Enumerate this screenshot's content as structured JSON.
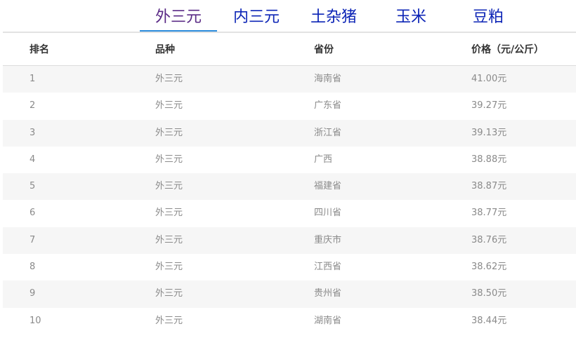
{
  "tabs": [
    {
      "label": "外三元",
      "active": true
    },
    {
      "label": "内三元",
      "active": false
    },
    {
      "label": "土杂猪",
      "active": false
    },
    {
      "label": "玉米",
      "active": false
    },
    {
      "label": "豆粕",
      "active": false
    }
  ],
  "table": {
    "headers": {
      "rank": "排名",
      "breed": "品种",
      "province": "省份",
      "price": "价格（元/公斤）"
    },
    "rows": [
      {
        "rank": "1",
        "breed": "外三元",
        "province": "海南省",
        "price": "41.00元"
      },
      {
        "rank": "2",
        "breed": "外三元",
        "province": "广东省",
        "price": "39.27元"
      },
      {
        "rank": "3",
        "breed": "外三元",
        "province": "浙江省",
        "price": "39.13元"
      },
      {
        "rank": "4",
        "breed": "外三元",
        "province": "广西",
        "price": "38.88元"
      },
      {
        "rank": "5",
        "breed": "外三元",
        "province": "福建省",
        "price": "38.87元"
      },
      {
        "rank": "6",
        "breed": "外三元",
        "province": "四川省",
        "price": "38.77元"
      },
      {
        "rank": "7",
        "breed": "外三元",
        "province": "重庆市",
        "price": "38.76元"
      },
      {
        "rank": "8",
        "breed": "外三元",
        "province": "江西省",
        "price": "38.62元"
      },
      {
        "rank": "9",
        "breed": "外三元",
        "province": "贵州省",
        "price": "38.50元"
      },
      {
        "rank": "10",
        "breed": "外三元",
        "province": "湖南省",
        "price": "38.44元"
      }
    ]
  },
  "colors": {
    "tab_text": "#0c24b6",
    "tab_active_text": "#5a2a86",
    "tab_underline": "#2b8bdc",
    "row_stripe": "#f6f6f6",
    "cell_text": "#8a8a8a",
    "header_text": "#333333"
  }
}
